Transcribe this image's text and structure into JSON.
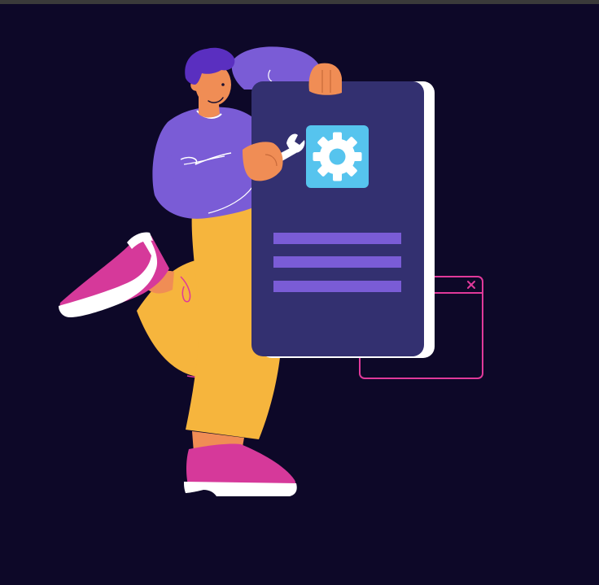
{
  "colors": {
    "background": "#0d0828",
    "top_strip": "#3a3a3a",
    "panel": "#333070",
    "panel_shadow": "#ffffff",
    "gear_tile": "#56c4ee",
    "gear": "#ffffff",
    "text_lines": "#7a5cd6",
    "window_outline": "#e0399a",
    "shirt": "#7a5cd6",
    "hair": "#5a2fc0",
    "skin": "#f08d55",
    "pants": "#f6b53d",
    "shoes": "#d6399a",
    "soles": "#ffffff",
    "outline": "#e0399a"
  },
  "icons": {
    "settings": "gear-icon",
    "wrench": "wrench-icon",
    "window_close": "close-icon"
  }
}
